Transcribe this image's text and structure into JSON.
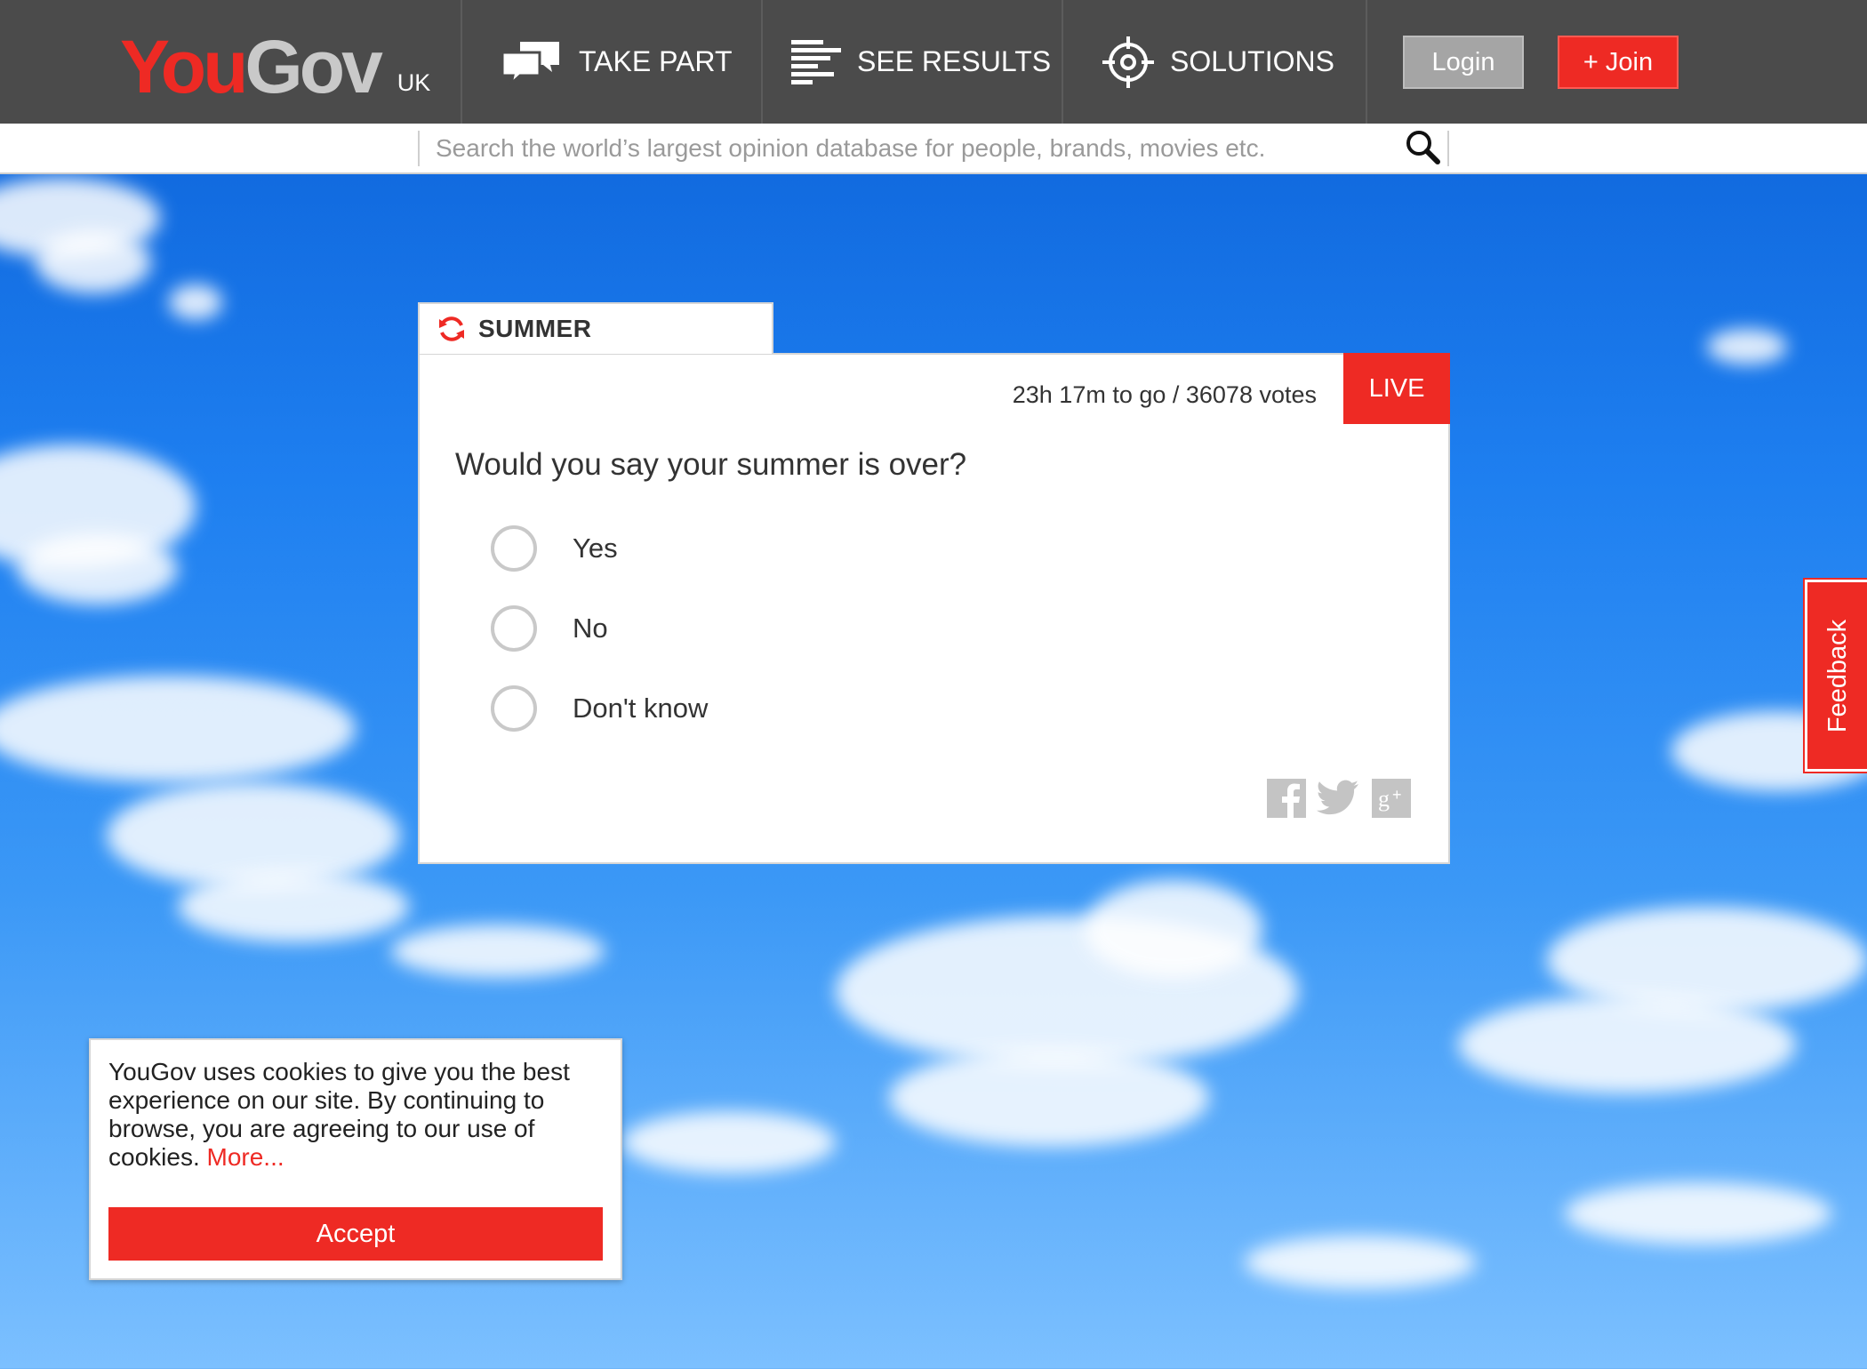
{
  "header": {
    "logo": {
      "you": "You",
      "gov": "Gov",
      "region": "UK"
    },
    "nav": [
      {
        "label": "TAKE PART",
        "icon": "speech-bubbles-icon"
      },
      {
        "label": "SEE RESULTS",
        "icon": "results-bars-icon"
      },
      {
        "label": "SOLUTIONS",
        "icon": "crosshair-icon"
      }
    ],
    "login_label": "Login",
    "join_label": "+ Join"
  },
  "search": {
    "placeholder": "Search the world’s largest opinion database for people, brands, movies etc.",
    "value": "",
    "icon": "search-icon"
  },
  "poll": {
    "tab_label": "SUMMER",
    "tab_icon": "refresh-icon",
    "meta": "23h 17m to go / 36078 votes",
    "live_label": "LIVE",
    "question": "Would you say your summer is over?",
    "options": [
      {
        "label": "Yes",
        "selected": false
      },
      {
        "label": "No",
        "selected": false
      },
      {
        "label": "Don't know",
        "selected": false
      }
    ],
    "share": [
      "facebook-icon",
      "twitter-icon",
      "google-plus-icon"
    ]
  },
  "feedback_label": "Feedback",
  "cookie": {
    "text": "YouGov uses cookies to give you the best experience on our site. By continuing to browse, you are agreeing to our use of cookies.",
    "more_label": "More...",
    "accept_label": "Accept"
  },
  "colors": {
    "brand_red": "#ee2a24",
    "header_bg": "#4b4b4b",
    "login_bg": "#a5a5a5",
    "sky_blue": "#1e7ff0"
  }
}
